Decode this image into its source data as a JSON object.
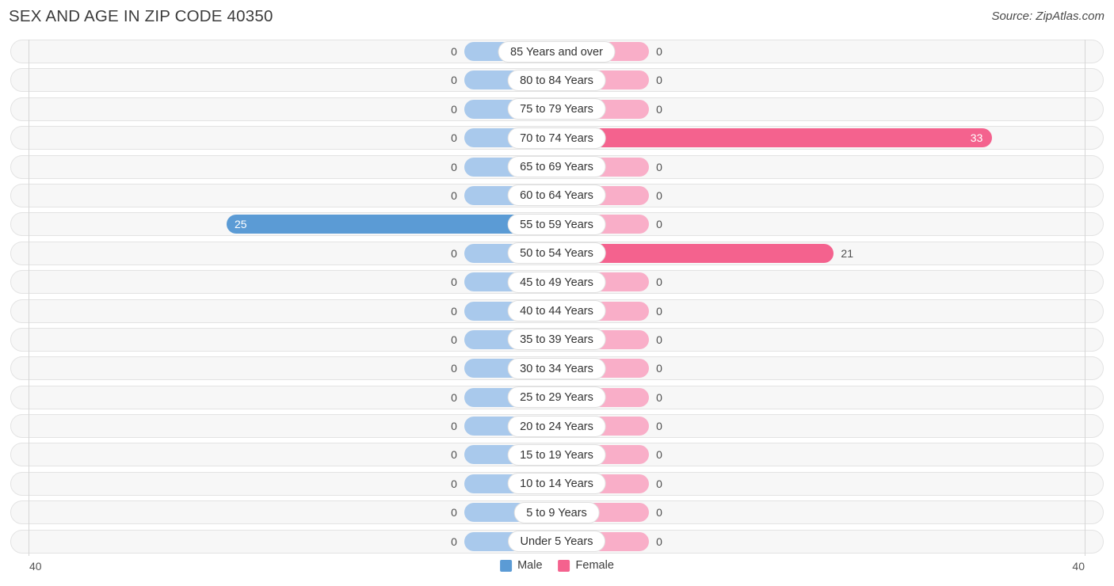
{
  "header": {
    "title": "SEX AND AGE IN ZIP CODE 40350",
    "source": "Source: ZipAtlas.com"
  },
  "legend": {
    "male_label": "Male",
    "female_label": "Female"
  },
  "axis": {
    "left_tick": "40",
    "right_tick": "40"
  },
  "colors": {
    "male_accent": "#5b9bd5",
    "female_accent": "#f4628e",
    "male_muted": "#a9c9ec",
    "female_muted": "#f9aec8"
  },
  "chart_data": {
    "type": "bar",
    "title": "SEX AND AGE IN ZIP CODE 40350",
    "subtitle": "Source: ZipAtlas.com",
    "orientation": "horizontal-diverging",
    "xlabel": "",
    "ylabel": "",
    "xlim": [
      40,
      40
    ],
    "grid": false,
    "legend_position": "bottom-center",
    "categories": [
      "85 Years and over",
      "80 to 84 Years",
      "75 to 79 Years",
      "70 to 74 Years",
      "65 to 69 Years",
      "60 to 64 Years",
      "55 to 59 Years",
      "50 to 54 Years",
      "45 to 49 Years",
      "40 to 44 Years",
      "35 to 39 Years",
      "30 to 34 Years",
      "25 to 29 Years",
      "20 to 24 Years",
      "15 to 19 Years",
      "10 to 14 Years",
      "5 to 9 Years",
      "Under 5 Years"
    ],
    "series": [
      {
        "name": "Male",
        "color": "#5b9bd5",
        "values": [
          0,
          0,
          0,
          0,
          0,
          0,
          25,
          0,
          0,
          0,
          0,
          0,
          0,
          0,
          0,
          0,
          0,
          0
        ]
      },
      {
        "name": "Female",
        "color": "#f4628e",
        "values": [
          0,
          0,
          0,
          33,
          0,
          0,
          0,
          21,
          0,
          0,
          0,
          0,
          0,
          0,
          0,
          0,
          0,
          0
        ]
      }
    ]
  },
  "rows": [
    {
      "category": "85 Years and over",
      "male": "0",
      "female": "0",
      "male_value": 0,
      "female_value": 0
    },
    {
      "category": "80 to 84 Years",
      "male": "0",
      "female": "0",
      "male_value": 0,
      "female_value": 0
    },
    {
      "category": "75 to 79 Years",
      "male": "0",
      "female": "0",
      "male_value": 0,
      "female_value": 0
    },
    {
      "category": "70 to 74 Years",
      "male": "0",
      "female": "33",
      "male_value": 0,
      "female_value": 33
    },
    {
      "category": "65 to 69 Years",
      "male": "0",
      "female": "0",
      "male_value": 0,
      "female_value": 0
    },
    {
      "category": "60 to 64 Years",
      "male": "0",
      "female": "0",
      "male_value": 0,
      "female_value": 0
    },
    {
      "category": "55 to 59 Years",
      "male": "25",
      "female": "0",
      "male_value": 25,
      "female_value": 0
    },
    {
      "category": "50 to 54 Years",
      "male": "0",
      "female": "21",
      "male_value": 0,
      "female_value": 21
    },
    {
      "category": "45 to 49 Years",
      "male": "0",
      "female": "0",
      "male_value": 0,
      "female_value": 0
    },
    {
      "category": "40 to 44 Years",
      "male": "0",
      "female": "0",
      "male_value": 0,
      "female_value": 0
    },
    {
      "category": "35 to 39 Years",
      "male": "0",
      "female": "0",
      "male_value": 0,
      "female_value": 0
    },
    {
      "category": "30 to 34 Years",
      "male": "0",
      "female": "0",
      "male_value": 0,
      "female_value": 0
    },
    {
      "category": "25 to 29 Years",
      "male": "0",
      "female": "0",
      "male_value": 0,
      "female_value": 0
    },
    {
      "category": "20 to 24 Years",
      "male": "0",
      "female": "0",
      "male_value": 0,
      "female_value": 0
    },
    {
      "category": "15 to 19 Years",
      "male": "0",
      "female": "0",
      "male_value": 0,
      "female_value": 0
    },
    {
      "category": "10 to 14 Years",
      "male": "0",
      "female": "0",
      "male_value": 0,
      "female_value": 0
    },
    {
      "category": "5 to 9 Years",
      "male": "0",
      "female": "0",
      "male_value": 0,
      "female_value": 0
    },
    {
      "category": "Under 5 Years",
      "male": "0",
      "female": "0",
      "male_value": 0,
      "female_value": 0
    }
  ]
}
